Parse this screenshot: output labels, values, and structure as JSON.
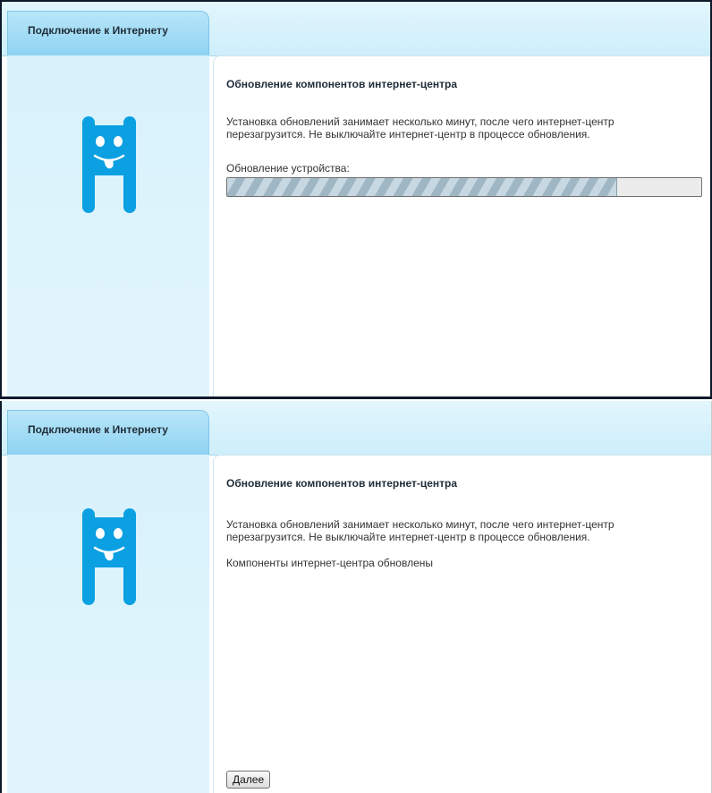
{
  "top_screen": {
    "tab_label": "Подключение к Интернету",
    "section_title": "Обновление компонентов интернет-центра",
    "description": "Установка обновлений занимает несколько минут, после чего интернет-центр перезагрузится. Не выключайте интернет-центр в процессе обновления.",
    "progress_label": "Обновление устройства:",
    "progress_percent": 82
  },
  "bottom_screen": {
    "tab_label": "Подключение к Интернету",
    "section_title": "Обновление компонентов интернет-центра",
    "description": "Установка обновлений занимает несколько минут, после чего интернет-центр перезагрузится. Не выключайте интернет-центр в процессе обновления.",
    "status_text": "Компоненты интернет-центра обновлены",
    "next_button_label": "Далее"
  },
  "colors": {
    "mascot": "#0aa0e2",
    "tab": "#a5ddf6",
    "sidebar": "#dcf3fc"
  }
}
